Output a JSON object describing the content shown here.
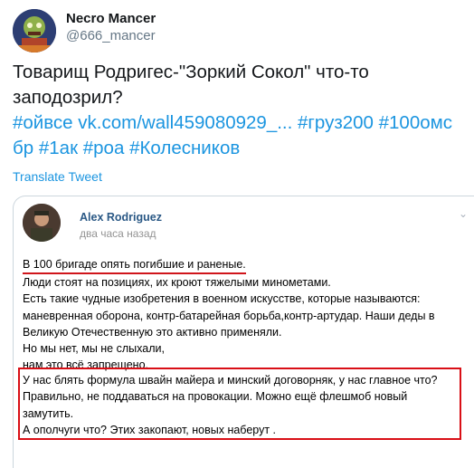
{
  "tweet": {
    "user_name": "Necro Mancer",
    "user_handle": "@666_mancer",
    "text_plain": "Товарищ Родригес-\"Зоркий Сокол\" что-то заподозрил?",
    "tags_line1": [
      "#ойвсе",
      "vk.com/wall459080929_...",
      "#груз200",
      "#100омс"
    ],
    "tags_line2": [
      "бр",
      "#1ак",
      "#роа",
      "#Колесников"
    ],
    "translate_label": "Translate Tweet"
  },
  "vk_post": {
    "author": "Alex Rodriguez",
    "time": "два часа назад",
    "lines": [
      "В 100 бригаде опять погибшие и раненые.",
      "Люди стоят на позициях, их кроют тяжелыми минометами.",
      "Есть такие чудные изобретения в военном искусстве, которые называются:",
      "маневренная оборона, контр-батарейная борьба,контр-артудар. Наши деды в",
      "Великую Отечественную это активно применяли.",
      "Но мы нет, мы не слыхали,",
      "нам это всё запрещено."
    ],
    "boxed_lines": [
      "У нас блять формула швайн майера и минский договорняк, у нас главное что?",
      "Правильно, не поддаваться на провокации. Можно ещё флешмоб новый",
      "замутить.",
      "А ополчуги что? Этих закопают, новых наберут ."
    ]
  },
  "colors": {
    "link": "#1b95e0",
    "vk_name": "#2a5885",
    "highlight": "#d90f16"
  },
  "icons": {
    "avatar": "zombie-avatar-image",
    "vk_avatar": "soldier-avatar-image",
    "vk_time_icon": "apple-icon",
    "vk_menu": "chevron-down-icon"
  }
}
